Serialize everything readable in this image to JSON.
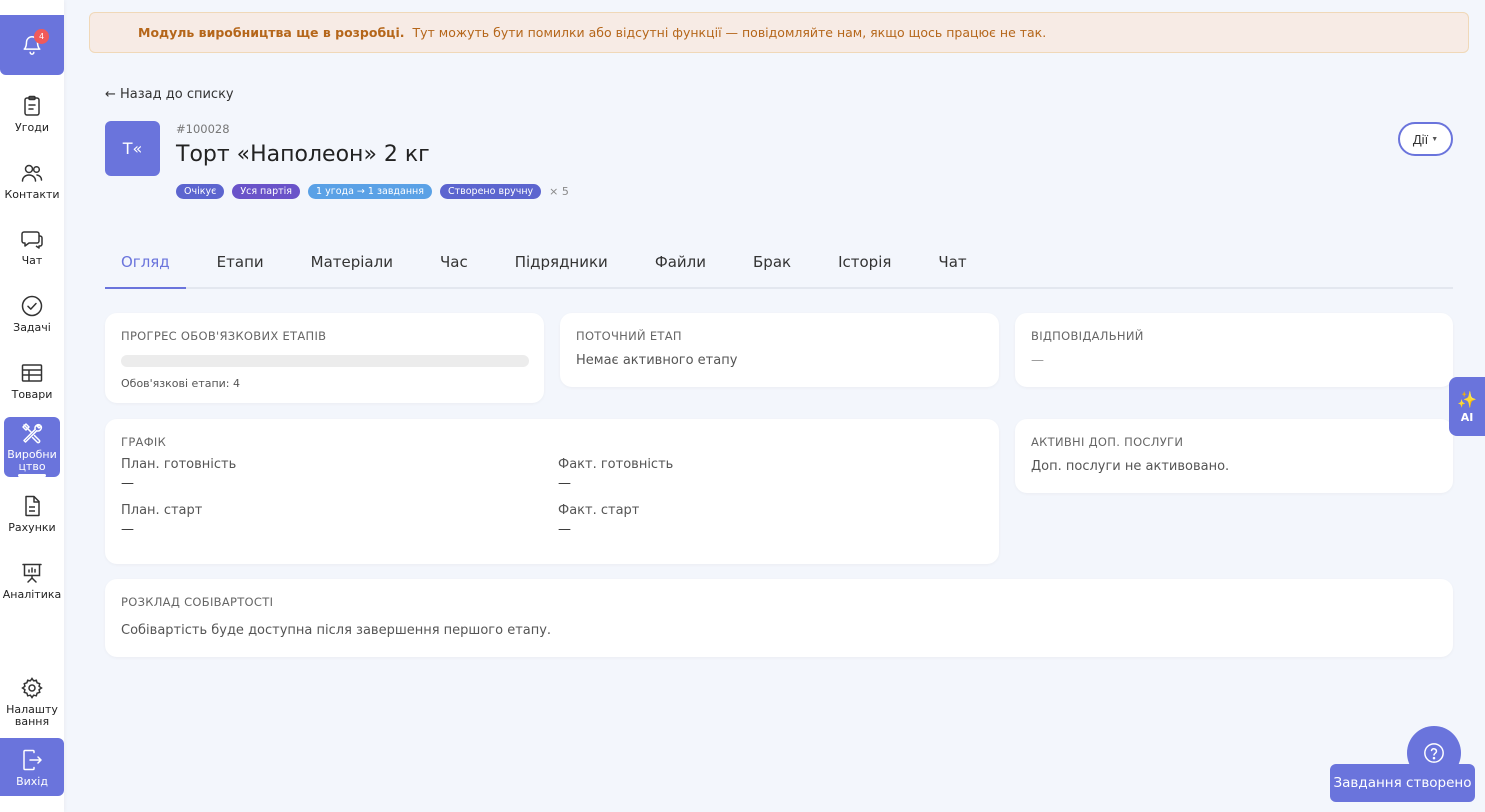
{
  "sidebar": {
    "notifications": {
      "count": "4",
      "icon": "bell-icon"
    },
    "items": [
      {
        "label": "Угоди",
        "icon": "clipboard-icon"
      },
      {
        "label": "Контакти",
        "icon": "users-icon"
      },
      {
        "label": "Чат",
        "icon": "chat-icon"
      },
      {
        "label": "Задачі",
        "icon": "check-circle-icon"
      },
      {
        "label": "Товари",
        "icon": "table-icon"
      },
      {
        "label": "Виробництво",
        "icon": "tools-icon"
      },
      {
        "label": "Рахунки",
        "icon": "document-icon"
      },
      {
        "label": "Аналітика",
        "icon": "presentation-icon"
      },
      {
        "label": "Налаштування",
        "icon": "gear-icon"
      },
      {
        "label": "Вихід",
        "icon": "logout-icon"
      }
    ]
  },
  "banner": {
    "strong": "Модуль виробництва ще в розробці.",
    "text": "Тут можуть бути помилки або відсутні функції — повідомляйте нам, якщо щось працює не так."
  },
  "back_link": "← Назад до списку",
  "header": {
    "avatar": "Т«",
    "order_no": "#100028",
    "title": "Торт «Наполеон» 2 кг",
    "tags": [
      "Очікує",
      "Уся партія",
      "1 угода → 1 завдання",
      "Створено вручну"
    ],
    "quantity": "× 5",
    "actions_label": "Дії"
  },
  "tabs": [
    "Огляд",
    "Етапи",
    "Матеріали",
    "Час",
    "Підрядники",
    "Файли",
    "Брак",
    "Історія",
    "Чат"
  ],
  "cards": {
    "progress": {
      "title": "Прогрес обов'язкових етапів",
      "caption": "Обов'язкові етапи: 4",
      "fraction": 0
    },
    "current_stage": {
      "title": "Поточний етап",
      "text": "Немає активного етапу"
    },
    "responsible": {
      "title": "Відповідальний",
      "text": "—"
    },
    "schedule": {
      "title": "Графік",
      "plan_ready_label": "План. готовність",
      "plan_ready_value": "—",
      "fact_ready_label": "Факт. готовність",
      "fact_ready_value": "—",
      "plan_start_label": "План. старт",
      "plan_start_value": "—",
      "fact_start_label": "Факт. старт",
      "fact_start_value": "—"
    },
    "services": {
      "title": "Активні доп. послуги",
      "text": "Доп. послуги не активовано."
    },
    "cost": {
      "title": "Розклад собівартості",
      "text": "Собівартість буде доступна після завершення першого етапу."
    }
  },
  "ai_label": "AI",
  "toast": "Завдання створено",
  "colors": {
    "accent": "#6a74dc",
    "banner_text": "#b5661a",
    "badge": "#f05a5a"
  }
}
